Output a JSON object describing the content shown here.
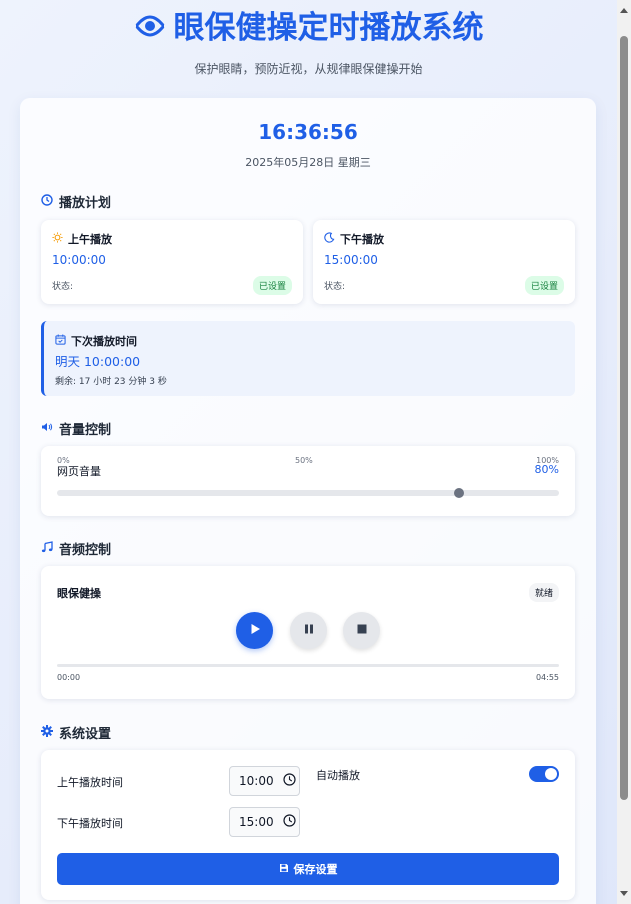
{
  "header": {
    "title": "眼保健操定时播放系统",
    "subtitle": "保护眼睛，预防近视，从规律眼保健操开始"
  },
  "clock": {
    "time": "16:36:56",
    "date": "2025年05月28日 星期三"
  },
  "schedule": {
    "title": "播放计划",
    "morning": {
      "label": "上午播放",
      "time": "10:00:00",
      "status_label": "状态:",
      "status": "已设置"
    },
    "afternoon": {
      "label": "下午播放",
      "time": "15:00:00",
      "status_label": "状态:",
      "status": "已设置"
    },
    "next": {
      "label": "下次播放时间",
      "time": "明天 10:00:00",
      "remaining": "剩余: 17 小时 23 分钟 3 秒"
    }
  },
  "volume": {
    "title": "音量控制",
    "label": "网页音量",
    "tick_min": "0%",
    "tick_mid": "50%",
    "tick_max": "100%",
    "value_label": "80%",
    "level": 0.8
  },
  "audio": {
    "title": "音频控制",
    "track_name": "眼保健操",
    "status": "就绪",
    "current_time": "00:00",
    "duration": "04:55",
    "progress": 0
  },
  "settings": {
    "title": "系统设置",
    "morning_label": "上午播放时间",
    "morning_value": "10:00",
    "afternoon_label": "下午播放时间",
    "afternoon_value": "15:00",
    "auto_label": "自动播放",
    "auto_enabled": true,
    "save_label": "保存设置"
  },
  "colors": {
    "accent": "#1f5fe6",
    "success_bg": "#dcfce7",
    "success_text": "#15803d"
  },
  "icons": {
    "title": "eye-icon",
    "schedule": "clock-icon",
    "morning": "sun-icon",
    "afternoon": "moon-icon",
    "next": "calendar-icon",
    "volume": "speaker-icon",
    "audio": "music-note-icon",
    "settings": "gear-icon",
    "save": "floppy-disk-icon"
  }
}
